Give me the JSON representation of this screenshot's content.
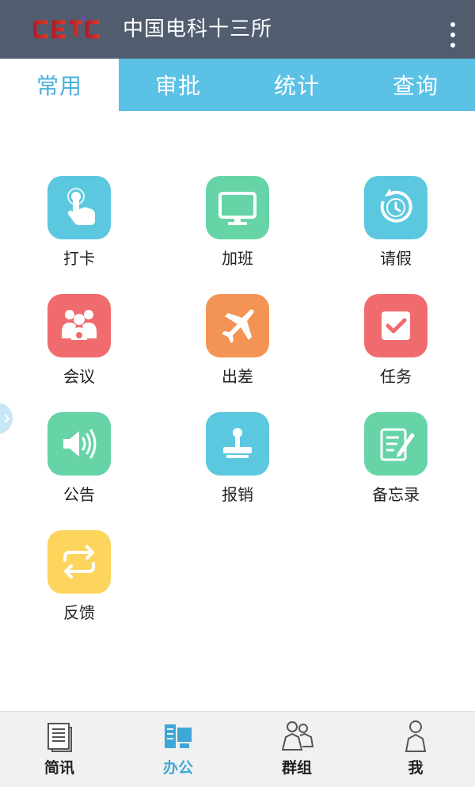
{
  "header": {
    "logo_text": "CETC",
    "title": "中国电科十三所",
    "menu_icon": "more-vertical-icon"
  },
  "tabs": [
    {
      "label": "常用",
      "active": true
    },
    {
      "label": "审批",
      "active": false
    },
    {
      "label": "统计",
      "active": false
    },
    {
      "label": "查询",
      "active": false
    }
  ],
  "apps": [
    {
      "label": "打卡",
      "icon": "touch-hand-icon",
      "color": "#5cc8df"
    },
    {
      "label": "加班",
      "icon": "monitor-icon",
      "color": "#66d4a7"
    },
    {
      "label": "请假",
      "icon": "clock-refresh-icon",
      "color": "#5cc8df"
    },
    {
      "label": "会议",
      "icon": "people-group-icon",
      "color": "#f06b6e"
    },
    {
      "label": "出差",
      "icon": "airplane-icon",
      "color": "#f39454"
    },
    {
      "label": "任务",
      "icon": "checkbox-icon",
      "color": "#f06b6e"
    },
    {
      "label": "公告",
      "icon": "speaker-icon",
      "color": "#66d4a7"
    },
    {
      "label": "报销",
      "icon": "stamp-icon",
      "color": "#5cc8df"
    },
    {
      "label": "备忘录",
      "icon": "memo-pen-icon",
      "color": "#66d4a7"
    },
    {
      "label": "反馈",
      "icon": "swap-arrows-icon",
      "color": "#fed55c"
    }
  ],
  "bottom_nav": [
    {
      "label": "简讯",
      "icon": "document-icon",
      "active": false
    },
    {
      "label": "办公",
      "icon": "office-icon",
      "active": true
    },
    {
      "label": "群组",
      "icon": "group-icon",
      "active": false
    },
    {
      "label": "我",
      "icon": "person-icon",
      "active": false
    }
  ],
  "colors": {
    "header_bg": "#515d6e",
    "tab_bg": "#5bc1e5",
    "tab_active_text": "#49b1db",
    "nav_active": "#3fa7d6"
  }
}
